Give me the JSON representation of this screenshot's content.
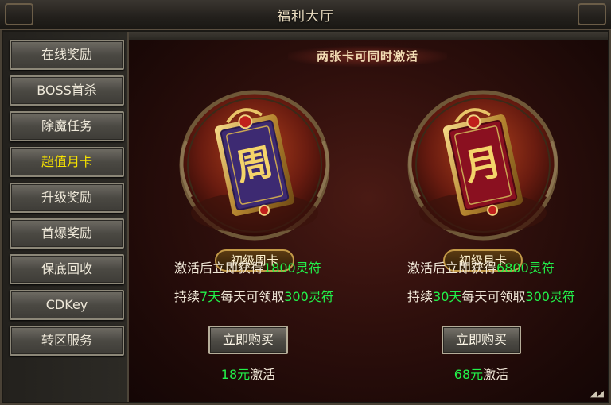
{
  "window": {
    "title": "福利大厅"
  },
  "sidebar": {
    "items": [
      {
        "label": "在线奖励",
        "active": false
      },
      {
        "label": "BOSS首杀",
        "active": false
      },
      {
        "label": "除魔任务",
        "active": false
      },
      {
        "label": "超值月卡",
        "active": true
      },
      {
        "label": "升级奖励",
        "active": false
      },
      {
        "label": "首爆奖励",
        "active": false
      },
      {
        "label": "保底回收",
        "active": false
      },
      {
        "label": "CDKey",
        "active": false
      },
      {
        "label": "转区服务",
        "active": false
      }
    ]
  },
  "main": {
    "banner": "两张卡可同时激活",
    "cards": [
      {
        "glyph": "周",
        "name": "初级周卡",
        "line1_prefix": "激活后立即获得",
        "line1_amount": "1800灵符",
        "line2_prefix": "持续",
        "line2_days": "7天",
        "line2_mid": "每天可领取",
        "line2_amount": "300灵符",
        "button": "立即购买",
        "price_amount": "18元",
        "price_suffix": "激活",
        "face_color": "#3d2a72"
      },
      {
        "glyph": "月",
        "name": "初级月卡",
        "line1_prefix": "激活后立即获得",
        "line1_amount": "6800灵符",
        "line2_prefix": "持续",
        "line2_days": "30天",
        "line2_mid": "每天可领取",
        "line2_amount": "300灵符",
        "button": "立即购买",
        "price_amount": "68元",
        "price_suffix": "激活",
        "face_color": "#8a1020"
      }
    ]
  },
  "colors": {
    "highlight": "#22f24a",
    "active_tab": "#f6e200",
    "gold": "#d8b25a"
  },
  "icons": {
    "resize": "resize-grip-icon"
  }
}
